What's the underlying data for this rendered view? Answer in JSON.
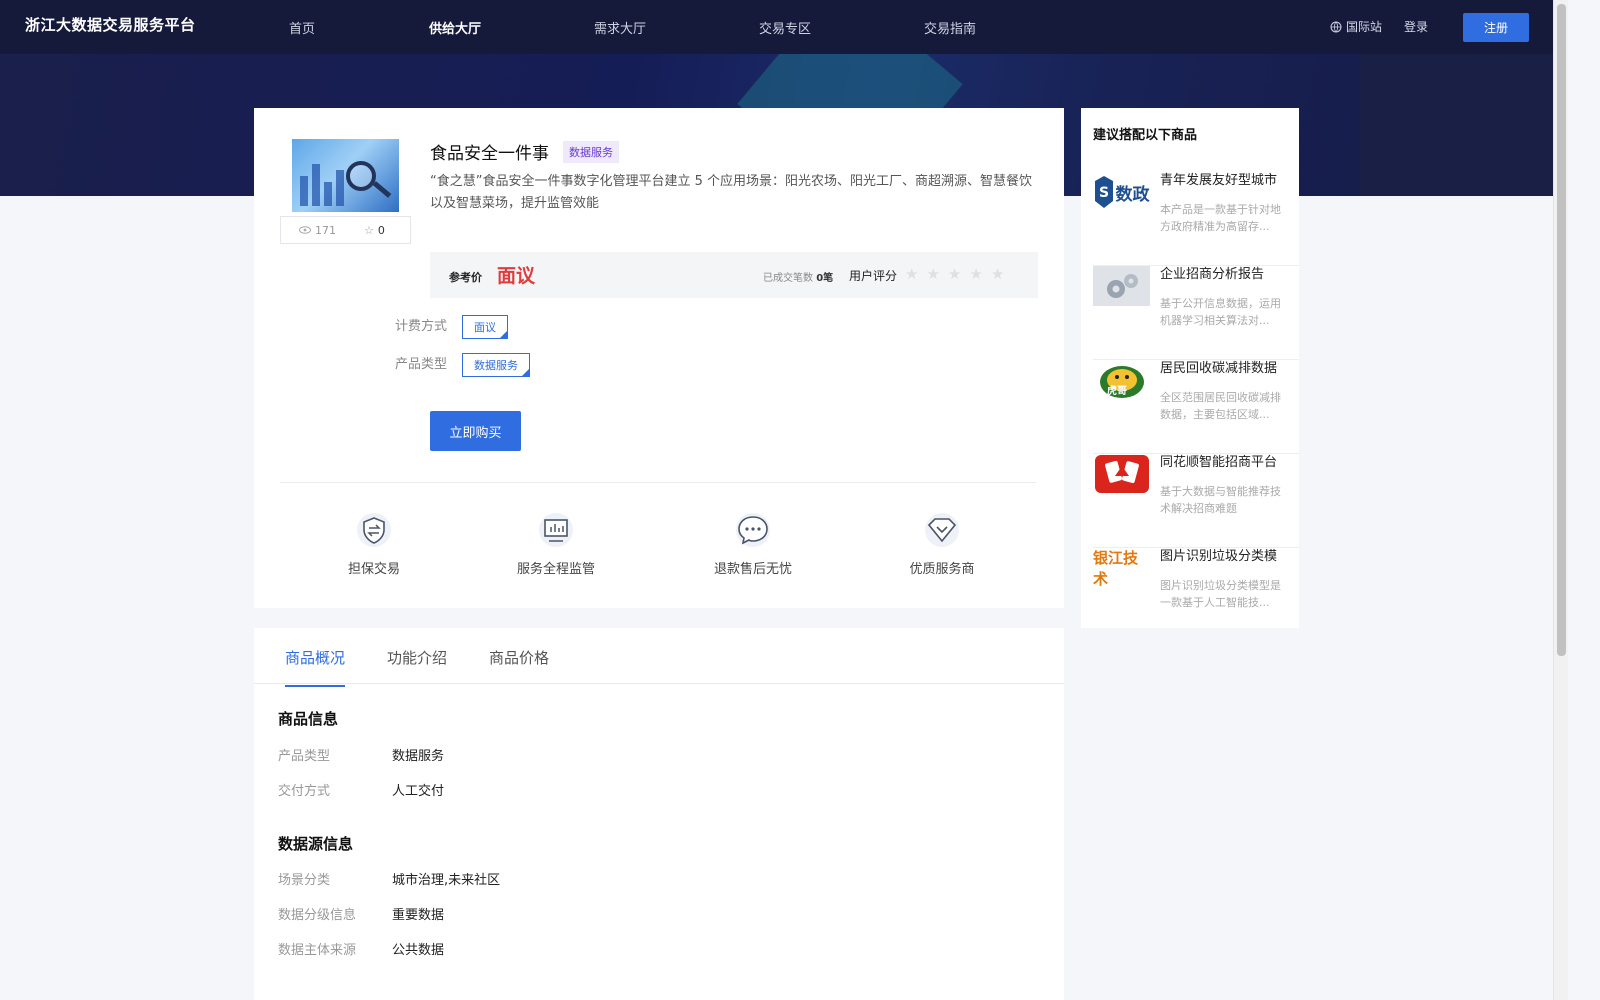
{
  "header": {
    "brand": "浙江大数据交易服务平台",
    "nav": [
      {
        "label": "首页"
      },
      {
        "label": "供给大厅"
      },
      {
        "label": "需求大厅"
      },
      {
        "label": "交易专区"
      },
      {
        "label": "交易指南"
      }
    ],
    "intl": "国际站",
    "login": "登录",
    "register": "注册"
  },
  "product": {
    "title": "食品安全一件事",
    "tag": "数据服务",
    "description": "“食之慧”食品安全一件事数字化管理平台建立 5 个应用场景：阳光农场、阳光工厂、商超溯源、智慧餐饮以及智慧菜场，提升监管效能",
    "views": "171",
    "favorites": "0",
    "price_label": "参考价",
    "price_value": "面议",
    "deals_label": "已成交笔数",
    "deals_value": "0笔",
    "rating_label": "用户评分",
    "rating": 0,
    "billing_label": "计费方式",
    "billing_value": "面议",
    "type_label": "产品类型",
    "type_value": "数据服务",
    "buy_button": "立即购买"
  },
  "features": [
    {
      "label": "担保交易",
      "icon": "shield-exchange-icon"
    },
    {
      "label": "服务全程监管",
      "icon": "monitor-chart-icon"
    },
    {
      "label": "退款售后无忧",
      "icon": "chat-bubble-icon"
    },
    {
      "label": "优质服务商",
      "icon": "diamond-check-icon"
    }
  ],
  "tabs": [
    {
      "label": "商品概况"
    },
    {
      "label": "功能介绍"
    },
    {
      "label": "商品价格"
    }
  ],
  "info": {
    "section1_title": "商品信息",
    "rows1": [
      {
        "label": "产品类型",
        "value": "数据服务"
      },
      {
        "label": "交付方式",
        "value": "人工交付"
      }
    ],
    "section2_title": "数据源信息",
    "rows2": [
      {
        "label": "场景分类",
        "value": "城市治理,未来社区"
      },
      {
        "label": "数据分级信息",
        "value": "重要数据"
      },
      {
        "label": "数据主体来源",
        "value": "公共数据"
      }
    ]
  },
  "sidebar": {
    "title": "建议搭配以下商品",
    "items": [
      {
        "name": "青年发展友好型城市",
        "desc": "本产品是一款基于针对地方政府精准为高留存...",
        "logo_text": "数政",
        "logo_color": "#1e4f8f"
      },
      {
        "name": "企业招商分析报告",
        "desc": "基于公开信息数据，运用机器学习相关算法对...",
        "logo_text": "",
        "logo_color": "#9aa4b0"
      },
      {
        "name": "居民回收碳减排数据",
        "desc": "全区范围居民回收碳减排数据，主要包括区域...",
        "logo_text": "虎哥",
        "logo_color": "#2b7a2b"
      },
      {
        "name": "同花顺智能招商平台",
        "desc": "基于大数据与智能推荐技术解决招商难题",
        "logo_text": "",
        "logo_color": "#d9251c"
      },
      {
        "name": "图片识别垃圾分类模",
        "desc": "图片识别垃圾分类模型是一款基于人工智能技...",
        "logo_text": "银江技术",
        "logo_color": "#e07a10"
      }
    ]
  },
  "colors": {
    "accent": "#2f6de0",
    "price": "#e03c3c",
    "header_bg": "#15193a"
  }
}
